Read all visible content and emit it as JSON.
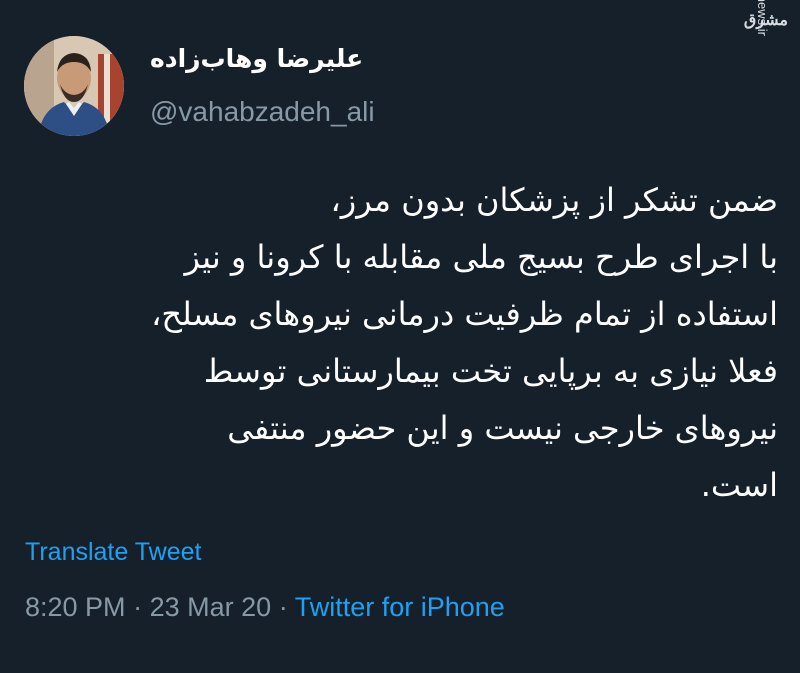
{
  "tweet": {
    "display_name": "علیرضا وهاب‌زاده",
    "handle": "@vahabzadeh_ali",
    "text_lines": [
      "ضمن تشکر از پزشکان بدون مرز،",
      "با اجرای طرح بسیج ملی مقابله با کرونا و نیز",
      "استفاده از تمام ظرفیت درمانی نیروهای مسلح،",
      "فعلا نیازی به برپایی تخت بیمارستانی توسط",
      "نیروهای خارجی نیست و این حضور منتفی",
      "است."
    ],
    "translate_label": "Translate Tweet",
    "time": "8:20 PM",
    "separator": "·",
    "date": "23 Mar 20",
    "source": "Twitter for iPhone"
  },
  "watermark": {
    "brand": "مشرق",
    "site": "mashreghnews.ir"
  },
  "colors": {
    "background": "#15202b",
    "text": "#ffffff",
    "muted": "#8899a6",
    "link": "#1da1f2"
  }
}
